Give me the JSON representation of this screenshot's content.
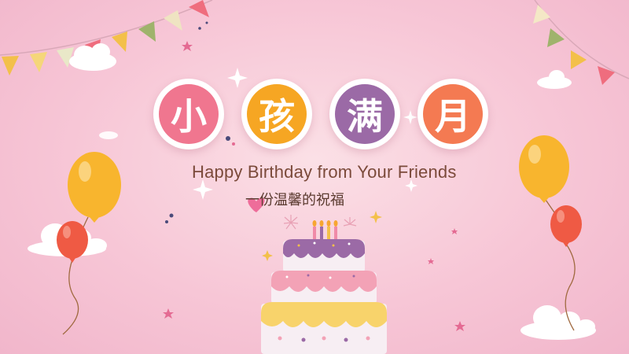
{
  "title": {
    "characters": [
      {
        "char": "小",
        "color": "#f0768f"
      },
      {
        "char": "孩",
        "color": "#f6a623"
      },
      {
        "char": "满",
        "color": "#9b6aa6"
      },
      {
        "char": "月",
        "color": "#f47a52"
      }
    ]
  },
  "subtitle_en": "Happy Birthday from Your Friends",
  "subtitle_cn": "一份温馨的祝福",
  "colors": {
    "background": "#f7c6d6",
    "balloon_orange": "#f8b52e",
    "balloon_red": "#ef5a44",
    "cake_purple": "#9b6aa6",
    "cake_pink": "#f3a2b6",
    "cake_yellow": "#f8d36b",
    "text_brown": "#7b4a3a"
  },
  "decorations": {
    "icons": [
      "bunting-flags-icon",
      "cloud-icon",
      "balloon-icon",
      "star-icon",
      "sparkle-icon",
      "heart-icon",
      "birthday-cake-icon",
      "candle-icon",
      "firework-icon"
    ]
  }
}
